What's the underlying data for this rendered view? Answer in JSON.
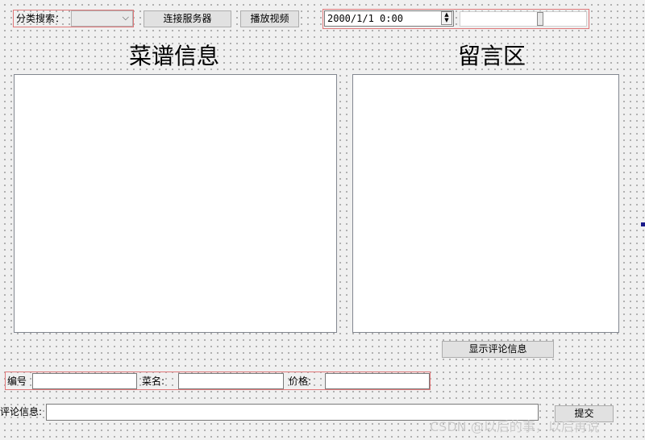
{
  "top_bar": {
    "category_label": "分类搜索：",
    "category_value": "",
    "connect_button": "连接服务器",
    "play_video_button": "播放视频",
    "datetime_value": "2000/1/1  0:00"
  },
  "panels": {
    "recipe_title": "菜谱信息",
    "comments_title": "留言区",
    "show_comments_button": "显示评论信息"
  },
  "form": {
    "id_label": "编号",
    "id_value": "",
    "dish_label": "菜名:",
    "dish_value": "",
    "price_label": "价格:",
    "price_value": "",
    "comment_label": "评论信息:",
    "comment_value": "",
    "submit_button": "提交"
  },
  "watermark": "CSDN @以后的事，以后再说",
  "icons": {
    "combo_arrow": "chevron-down-icon",
    "spin_up": "spin-up-icon",
    "spin_down": "spin-down-icon"
  },
  "colors": {
    "group_border": "#e0787a",
    "button_bg": "#e1e1e1",
    "canvas_bg": "#f0f0f0"
  }
}
